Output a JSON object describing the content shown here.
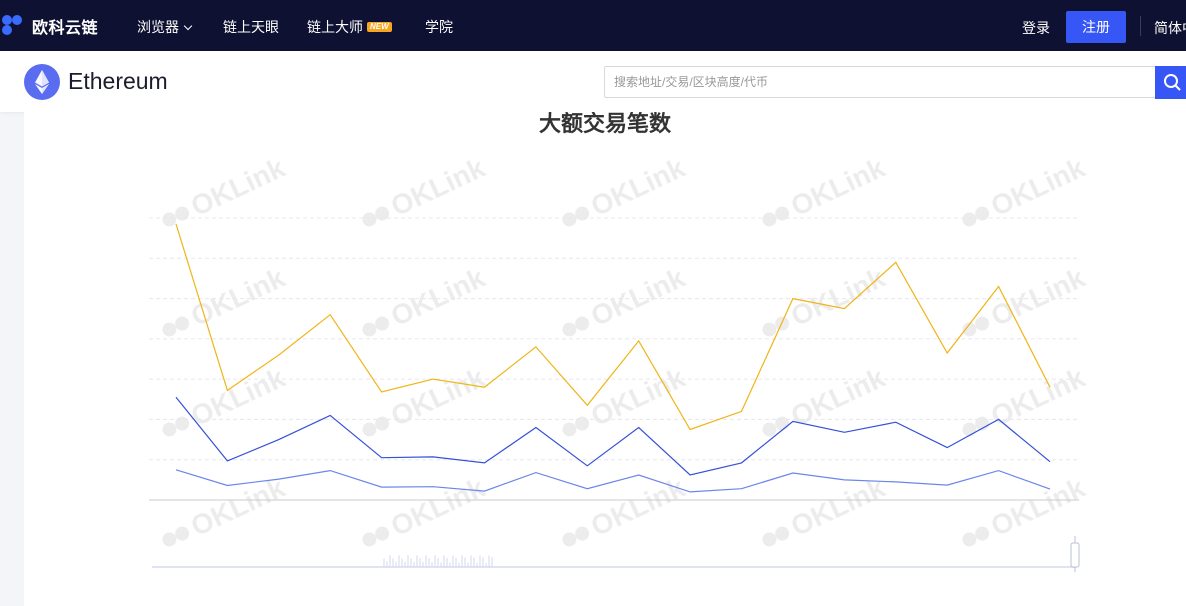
{
  "topnav": {
    "brand": "欧科云链",
    "items": [
      {
        "label": "浏览器",
        "has_dropdown": true
      },
      {
        "label": "链上天眼"
      },
      {
        "label": "链上大师",
        "badge": "NEW"
      },
      {
        "label": "学院"
      }
    ],
    "login": "登录",
    "register": "注册",
    "language": "简体中"
  },
  "subbar": {
    "chain_name": "Ethereum",
    "search_placeholder": "搜索地址/交易/区块高度/代币"
  },
  "watermark": "OKLink",
  "colors": {
    "nav_bg": "#0e1131",
    "accent": "#3657f5",
    "series_1": "#f0b417",
    "series_2": "#3550d8",
    "series_3": "#6b86ea"
  },
  "chart_data": {
    "type": "line",
    "title": "大额交易笔数",
    "x": [
      1,
      2,
      3,
      4,
      5,
      6,
      7,
      8,
      9,
      10,
      11,
      12,
      13,
      14,
      15,
      16,
      17,
      18
    ],
    "ylim": [
      0,
      7
    ],
    "grid": true,
    "series": [
      {
        "values": [
          6.85,
          2.72,
          3.6,
          4.6,
          2.68,
          3.0,
          2.8,
          3.8,
          2.35,
          3.95,
          1.75,
          2.2,
          5.0,
          4.75,
          5.9,
          3.65,
          5.3,
          2.8
        ]
      },
      {
        "values": [
          2.55,
          0.97,
          1.5,
          2.1,
          1.05,
          1.07,
          0.92,
          1.8,
          0.85,
          1.8,
          0.62,
          0.92,
          1.95,
          1.68,
          1.93,
          1.3,
          2.0,
          0.95
        ]
      },
      {
        "values": [
          0.75,
          0.36,
          0.52,
          0.73,
          0.32,
          0.33,
          0.22,
          0.68,
          0.28,
          0.62,
          0.2,
          0.28,
          0.67,
          0.5,
          0.45,
          0.37,
          0.73,
          0.27
        ]
      }
    ]
  }
}
